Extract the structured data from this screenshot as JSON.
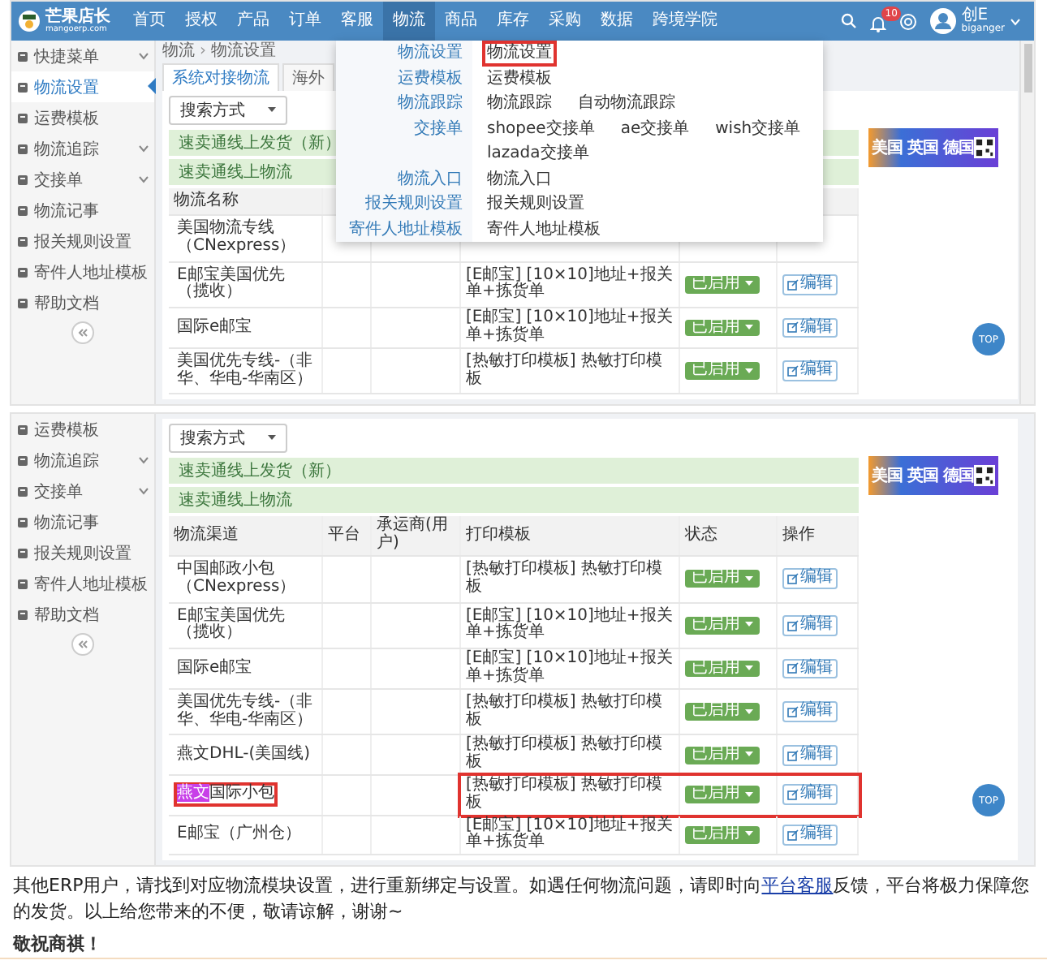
{
  "top_screenshot": {
    "nav": {
      "logo_title": "芒果店长",
      "logo_subtitle": "mangoerp.com",
      "items": [
        {
          "label": "首页",
          "selected": false
        },
        {
          "label": "授权",
          "selected": false
        },
        {
          "label": "产品",
          "selected": false
        },
        {
          "label": "订单",
          "selected": false
        },
        {
          "label": "客服",
          "selected": false
        },
        {
          "label": "物流",
          "selected": true
        },
        {
          "label": "商品",
          "selected": false
        },
        {
          "label": "库存",
          "selected": false
        },
        {
          "label": "采购",
          "selected": false
        },
        {
          "label": "数据",
          "selected": false
        },
        {
          "label": "跨境学院",
          "selected": false
        }
      ],
      "notification_count": "10",
      "user_name": "创E",
      "user_id": "biganger"
    },
    "sidebar": {
      "items": [
        {
          "label": "快捷菜单",
          "selected": false,
          "expandable": true
        },
        {
          "label": "物流设置",
          "selected": true,
          "expandable": false
        },
        {
          "label": "运费模板",
          "selected": false,
          "expandable": false
        },
        {
          "label": "物流追踪",
          "selected": false,
          "expandable": true
        },
        {
          "label": "交接单",
          "selected": false,
          "expandable": true
        },
        {
          "label": "物流记事",
          "selected": false,
          "expandable": false
        },
        {
          "label": "报关规则设置",
          "selected": false,
          "expandable": false
        },
        {
          "label": "寄件人地址模板",
          "selected": false,
          "expandable": false
        },
        {
          "label": "帮助文档",
          "selected": false,
          "expandable": false
        }
      ]
    },
    "breadcrumb": [
      "物流",
      "物流设置"
    ],
    "breadcrumb_separator": "›",
    "tabs": [
      {
        "label": "系统对接物流",
        "selected": true
      },
      {
        "label": "海外",
        "selected": false
      }
    ],
    "search_select": "搜索方式",
    "sections": [
      "速卖通线上发货（新）",
      "速卖通线上物流"
    ],
    "table": {
      "columns": [
        "物流名称"
      ],
      "rows": [
        {
          "name": "美国物流专线（CNexpress）"
        },
        {
          "name": "E邮宝美国优先（揽收）",
          "template": "[E邮宝] [10×10]地址+报关单+拣货单",
          "status": "已启用",
          "action": "编辑"
        },
        {
          "name": "国际e邮宝",
          "template": "[E邮宝] [10×10]地址+报关单+拣货单",
          "status": "已启用",
          "action": "编辑"
        },
        {
          "name": "美国优先专线-（非华、华电-华南区）",
          "template": "[热敏打印模板] 热敏打印模板",
          "status": "已启用",
          "action": "编辑"
        }
      ]
    },
    "mega_menu": {
      "rows": [
        {
          "label": "物流设置",
          "links": [
            {
              "label": "物流设置",
              "boxed": true
            }
          ]
        },
        {
          "label": "运费模板",
          "links": [
            {
              "label": "运费模板",
              "boxed": false
            }
          ]
        },
        {
          "label": "物流跟踪",
          "links": [
            {
              "label": "物流跟踪",
              "boxed": false
            },
            {
              "label": "自动物流跟踪",
              "boxed": false
            }
          ]
        },
        {
          "label": "交接单",
          "links": [
            {
              "label": "shopee交接单",
              "boxed": false
            },
            {
              "label": "ae交接单",
              "boxed": false
            },
            {
              "label": "wish交接单",
              "boxed": false
            },
            {
              "label": "lazada交接单",
              "boxed": false
            }
          ]
        },
        {
          "label": "物流入口",
          "links": [
            {
              "label": "物流入口",
              "boxed": false
            }
          ]
        },
        {
          "label": "报关规则设置",
          "links": [
            {
              "label": "报关规则设置",
              "boxed": false
            }
          ]
        },
        {
          "label": "寄件人地址模板",
          "links": [
            {
              "label": "寄件人地址模板",
              "boxed": false
            }
          ]
        }
      ]
    },
    "banner": {
      "headline": "美国 英国 德国"
    },
    "back_to_top": "TOP"
  },
  "bottom_screenshot": {
    "sidebar": {
      "items": [
        {
          "label": "运费模板",
          "selected": false,
          "expandable": false
        },
        {
          "label": "物流追踪",
          "selected": false,
          "expandable": true
        },
        {
          "label": "交接单",
          "selected": false,
          "expandable": true
        },
        {
          "label": "物流记事",
          "selected": false,
          "expandable": false
        },
        {
          "label": "报关规则设置",
          "selected": false,
          "expandable": false
        },
        {
          "label": "寄件人地址模板",
          "selected": false,
          "expandable": false
        },
        {
          "label": "帮助文档",
          "selected": false,
          "expandable": false
        }
      ]
    },
    "search_select": "搜索方式",
    "sections": [
      "速卖通线上发货（新）",
      "速卖通线上物流"
    ],
    "table": {
      "columns": [
        "物流渠道",
        "平台",
        "承运商(用户)",
        "打印模板",
        "状态",
        "操作"
      ],
      "rows": [
        {
          "name": "中国邮政小包（CNexpress）",
          "template": "[热敏打印模板] 热敏打印模板",
          "status": "已启用",
          "action": "编辑",
          "boxed": false
        },
        {
          "name": "E邮宝美国优先（揽收）",
          "template": "[E邮宝] [10×10]地址+报关单+拣货单",
          "status": "已启用",
          "action": "编辑",
          "boxed": false
        },
        {
          "name": "国际e邮宝",
          "template": "[E邮宝] [10×10]地址+报关单+拣货单",
          "status": "已启用",
          "action": "编辑",
          "boxed": false
        },
        {
          "name": "美国优先专线-（非华、华电-华南区）",
          "template": "[热敏打印模板] 热敏打印模板",
          "status": "已启用",
          "action": "编辑",
          "boxed": false
        },
        {
          "name": "燕文DHL-(美国线)",
          "template": "[热敏打印模板] 热敏打印模板",
          "status": "已启用",
          "action": "编辑",
          "boxed": false
        },
        {
          "name_marked": "燕文",
          "name": "国际小包",
          "template": "[热敏打印模板] 热敏打印模板",
          "status": "已启用",
          "action": "编辑",
          "boxed": true
        },
        {
          "name": "E邮宝（广州仓）",
          "template": "[E邮宝] [10×10]地址+报关单+拣货单",
          "status": "已启用",
          "action": "编辑",
          "boxed": false
        }
      ]
    },
    "banner": {
      "headline": "美国 英国 德国"
    },
    "back_to_top": "TOP"
  },
  "notice": {
    "text_before": "其他ERP用户，请找到对应物流模块设置，进行重新绑定与设置。如遇任何物流问题，请即时向",
    "link": "平台客服",
    "text_after": "反馈，平台将极力保障您的发货。以上给您带来的不便，敬请谅解，谢谢~",
    "closing": "敬祝商祺！"
  }
}
